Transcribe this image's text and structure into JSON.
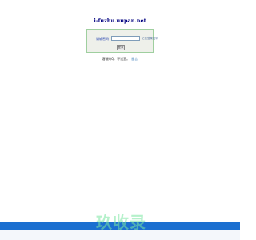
{
  "site": {
    "title": "i-fuzhu.uupan.net"
  },
  "login": {
    "password_label": "请输密码",
    "password_value": "",
    "remember_label": "记住登录密码",
    "submit_label": "登录"
  },
  "footer": {
    "text": "客服QQ：不设置。",
    "link": "留言"
  },
  "watermark": {
    "text": "玖收录"
  },
  "colors": {
    "bottom_bar": "#1b6fd0",
    "title": "#000080",
    "box_border": "#9fcf9f"
  }
}
